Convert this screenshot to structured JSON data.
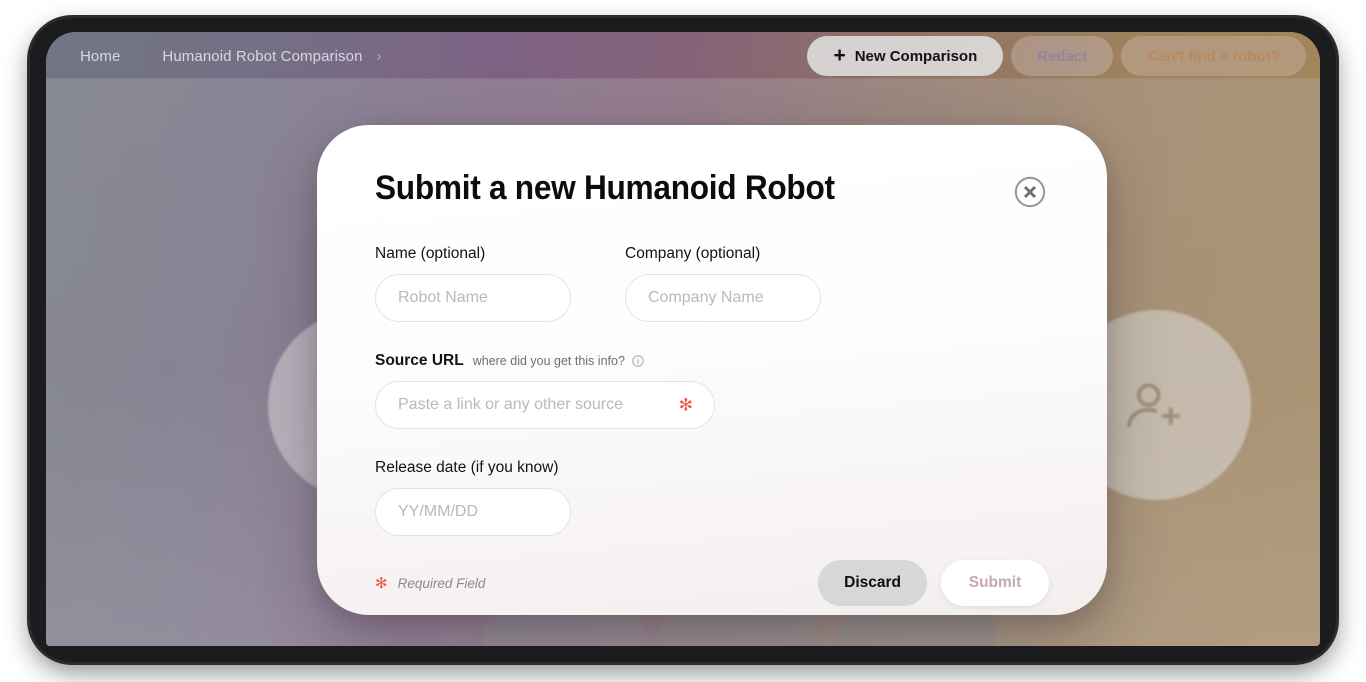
{
  "topbar": {
    "breadcrumb": {
      "home": "Home",
      "current": "Humanoid Robot Comparison",
      "separator": "›"
    },
    "buttons": {
      "new_comparison": "New Comparison",
      "new_comparison_icon": "plus-icon",
      "redact": "Redact",
      "cant_find": "Can't find a robot?"
    }
  },
  "modal": {
    "title": "Submit a new Humanoid Robot",
    "close_icon": "close-circle-icon",
    "fields": {
      "name": {
        "label": "Name (optional)",
        "placeholder": "Robot Name",
        "value": ""
      },
      "company": {
        "label": "Company (optional)",
        "placeholder": "Company Name",
        "value": ""
      },
      "source_url": {
        "label": "Source URL",
        "hint": "where did you get this info?",
        "hint_icon": "info-icon",
        "placeholder": "Paste a link or any other source",
        "value": "",
        "required_marker": "✻"
      },
      "release_date": {
        "label": "Release date (if you know)",
        "placeholder": "YY/MM/DD",
        "value": ""
      }
    },
    "footer": {
      "required_marker": "✻",
      "required_note": "Required Field",
      "discard": "Discard",
      "submit": "Submit"
    }
  },
  "colors": {
    "required_red": "#f2544a",
    "discard_bg": "#d7d7d7",
    "submit_text": "#c4a9ad",
    "redact_text": "#9682a5",
    "cant_find_text": "#b9875f"
  }
}
